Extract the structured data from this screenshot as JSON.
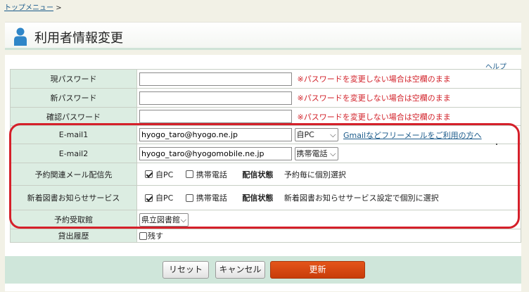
{
  "breadcrumb": {
    "top_menu": "トップメニュー",
    "separator": ">"
  },
  "page": {
    "title": "利用者情報変更",
    "icon": "user-icon"
  },
  "help": {
    "label": "ヘルプ"
  },
  "password": {
    "current_label": "現パスワード",
    "new_label": "新パスワード",
    "confirm_label": "確認パスワード",
    "note": "※パスワードを変更しない場合は空欄のまま"
  },
  "email1": {
    "label": "E-mail1",
    "value": "hyogo_taro@hyogo.ne.jp",
    "device": "自PC",
    "link": "Gmailなどフリーメールをご利用の方へ"
  },
  "email2": {
    "label": "E-mail2",
    "value": "hyogo_taro@hyogomobile.ne.jp",
    "device": "携帯電話"
  },
  "reservation_mail": {
    "label": "予約関連メール配信先",
    "opt_pc": "自PC",
    "opt_pc_checked": true,
    "opt_mobile": "携帯電話",
    "opt_mobile_checked": false,
    "status_label": "配信状態",
    "status_text": "予約毎に個別選択"
  },
  "new_books": {
    "label": "新着図書お知らせサービス",
    "opt_pc": "自PC",
    "opt_pc_checked": true,
    "opt_mobile": "携帯電話",
    "opt_mobile_checked": false,
    "status_label": "配信状態",
    "status_text": "新着図書お知らせサービス設定で個別に選択"
  },
  "pickup": {
    "label": "予約受取館",
    "value": "県立図書館"
  },
  "history": {
    "label": "貸出履歴",
    "option": "残す",
    "checked": false
  },
  "buttons": {
    "reset": "リセット",
    "cancel": "キャンセル",
    "update": "更新"
  },
  "colors": {
    "highlight": "#d5202a",
    "update_button": "#d4480f",
    "label_bg": "#dcede2",
    "footer_bg": "#cfe6da"
  }
}
